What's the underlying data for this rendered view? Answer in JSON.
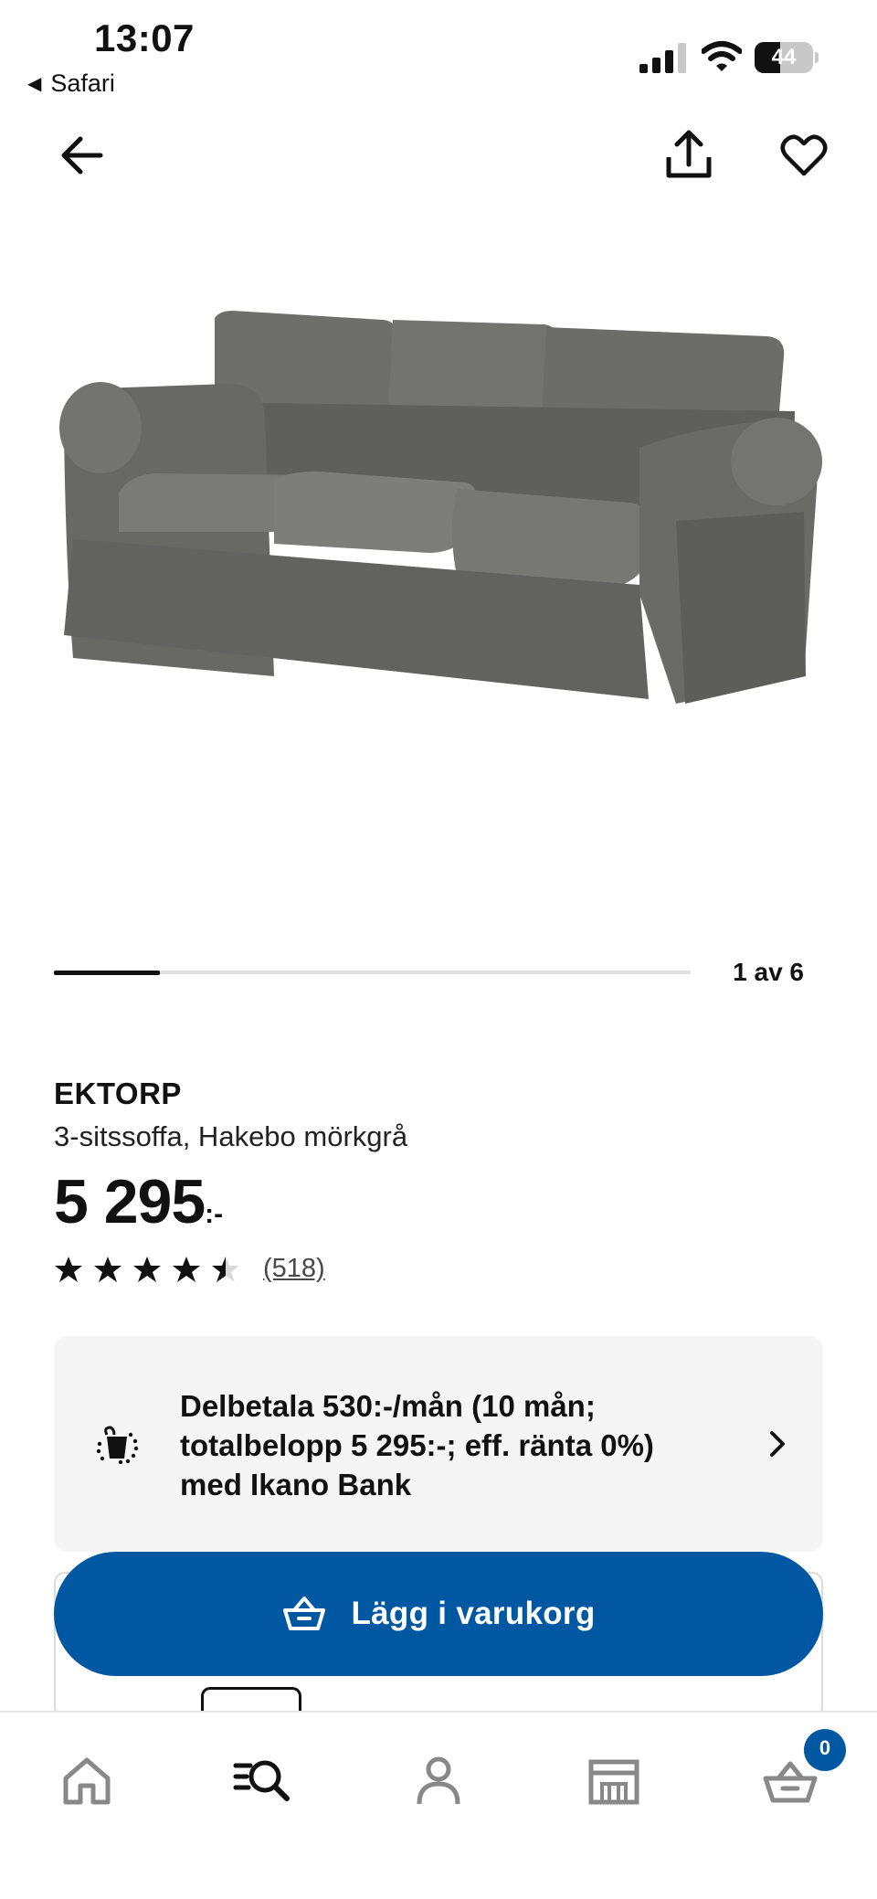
{
  "status_bar": {
    "time": "13:07",
    "back_app": "Safari",
    "battery": "44",
    "battery_level": 0.44
  },
  "nav": {
    "back_icon": "arrow-left-icon",
    "share_icon": "share-icon",
    "favorite_icon": "heart-icon"
  },
  "carousel": {
    "counter": "1 av 6",
    "current": 1,
    "total": 6
  },
  "product": {
    "brand": "EKTORP",
    "description": "3-sitssoffa, Hakebo mörkgrå",
    "price": "5 295",
    "price_suffix": ":-",
    "rating": 4.5,
    "rating_max": 5,
    "reviews": "(518)"
  },
  "payment": {
    "text": "Delbetala 530:-/mån (10 mån; totalbelopp 5 295:-; eff. ränta 0%) med Ikano Bank",
    "icon": "installment-icon"
  },
  "cta": {
    "label": "Lägg i varukorg",
    "icon": "basket-icon",
    "color": "#0058a3"
  },
  "tabbar": {
    "items": [
      {
        "icon": "home-icon"
      },
      {
        "icon": "search-icon"
      },
      {
        "icon": "profile-icon"
      },
      {
        "icon": "store-icon"
      },
      {
        "icon": "cart-icon"
      }
    ],
    "cart_badge": "0"
  }
}
